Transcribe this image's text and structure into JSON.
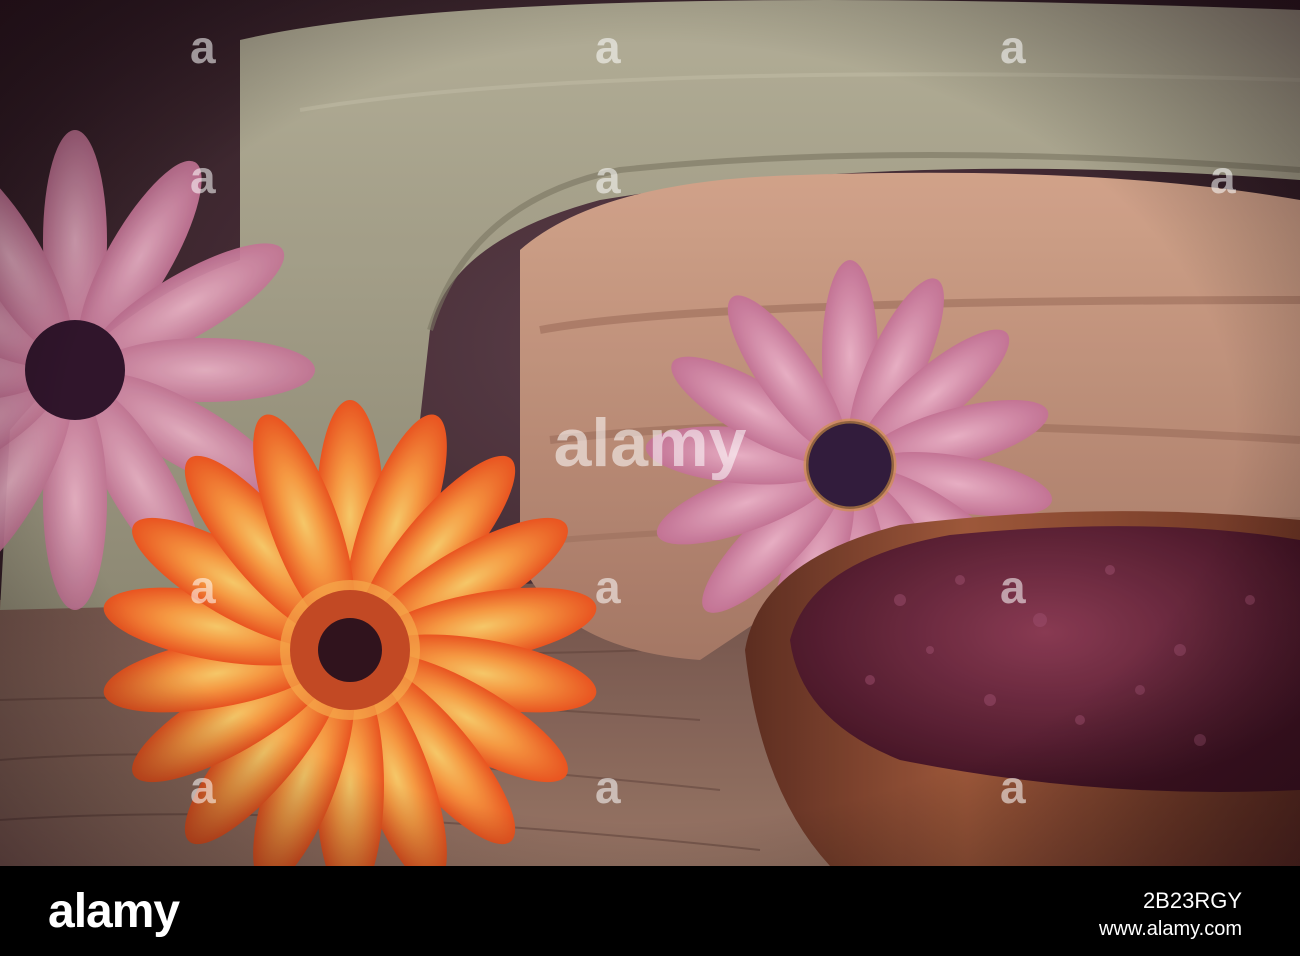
{
  "watermark": {
    "brand": "alamy",
    "tile_text": "a"
  },
  "footer": {
    "logo": "alamy",
    "image_id": "2B23RGY",
    "site": "www.alamy.com"
  },
  "colors": {
    "background": "#2a1a22",
    "towel_green": "#a9a98e",
    "towel_peach": "#c89a80",
    "orange_flower": "#f46a1e",
    "pink_flower": "#d98aa6",
    "bowl_wood": "#8a4a30",
    "salt": "#5a1c2e",
    "wood_table": "#8a6a56"
  },
  "scene": {
    "subjects": [
      "orange-gerbera-flower",
      "pink-daisy-flower",
      "pink-daisy-flower",
      "rolled-towel",
      "rolled-towel",
      "bath-salt-bowl",
      "wooden-table"
    ]
  }
}
